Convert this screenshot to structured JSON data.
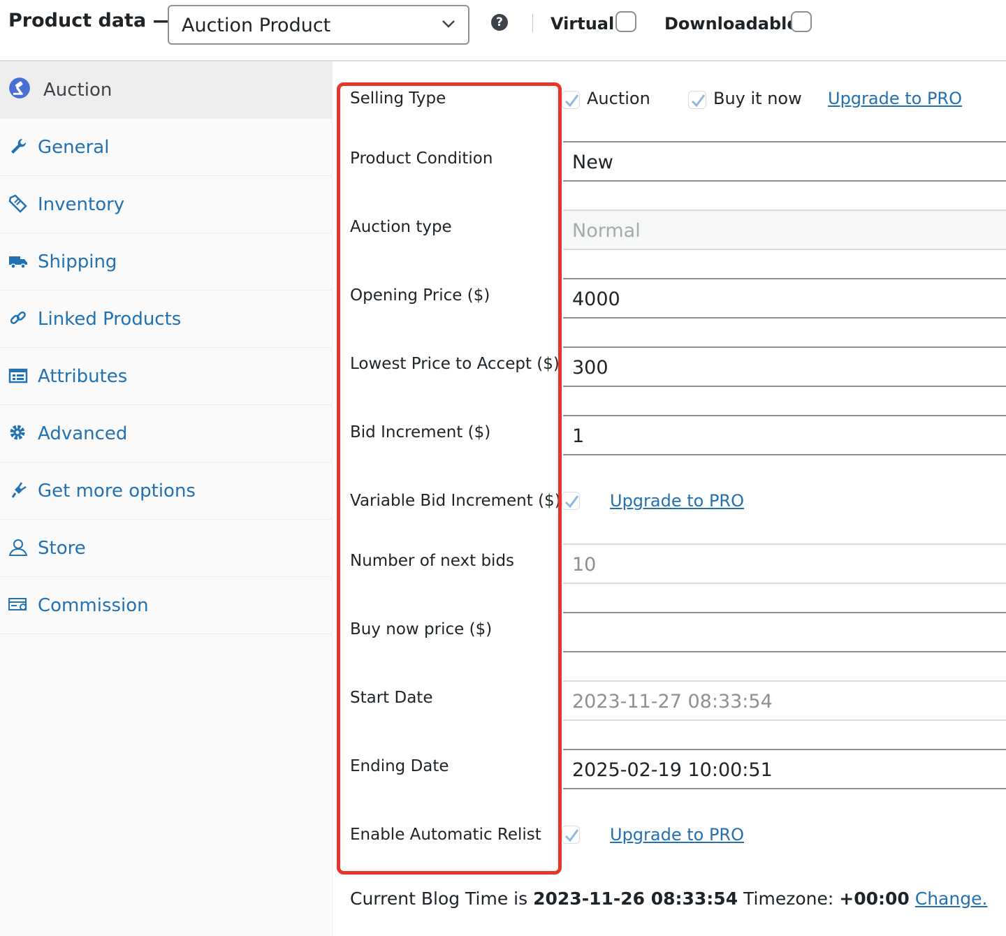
{
  "header": {
    "title": "Product data —",
    "product_type": "Auction Product",
    "help_symbol": "?",
    "virtual_label": "Virtual:",
    "downloadable_label": "Downloadable:"
  },
  "sidebar": {
    "items": [
      {
        "label": "Auction",
        "icon": "auction-icon",
        "active": true
      },
      {
        "label": "General",
        "icon": "wrench-icon"
      },
      {
        "label": "Inventory",
        "icon": "tag-icon"
      },
      {
        "label": "Shipping",
        "icon": "truck-icon"
      },
      {
        "label": "Linked Products",
        "icon": "link-icon"
      },
      {
        "label": "Attributes",
        "icon": "list-icon"
      },
      {
        "label": "Advanced",
        "icon": "gear-icon"
      },
      {
        "label": "Get more options",
        "icon": "plug-icon"
      },
      {
        "label": "Store",
        "icon": "user-icon"
      },
      {
        "label": "Commission",
        "icon": "card-icon"
      }
    ]
  },
  "form": {
    "selling_type": {
      "label": "Selling Type",
      "options": [
        {
          "label": "Auction",
          "checked": true
        },
        {
          "label": "Buy it now",
          "checked": true
        }
      ],
      "upgrade": "Upgrade to PRO"
    },
    "product_condition": {
      "label": "Product Condition",
      "value": "New"
    },
    "auction_type": {
      "label": "Auction type",
      "value": "Normal"
    },
    "opening_price": {
      "label": "Opening Price ($)",
      "value": "4000"
    },
    "lowest_price": {
      "label": "Lowest Price to Accept ($)",
      "value": "300"
    },
    "bid_increment": {
      "label": "Bid Increment ($)",
      "value": "1"
    },
    "variable_bid_increment": {
      "label": "Variable Bid Increment ($)",
      "checked": true,
      "upgrade": "Upgrade to PRO"
    },
    "next_bids": {
      "label": "Number of next bids",
      "value": "10"
    },
    "buy_now_price": {
      "label": "Buy now price ($)",
      "value": ""
    },
    "start_date": {
      "label": "Start Date",
      "value": "2023-11-27 08:33:54"
    },
    "ending_date": {
      "label": "Ending Date",
      "value": "2025-02-19 10:00:51"
    },
    "auto_relist": {
      "label": "Enable Automatic Relist",
      "checked": true,
      "upgrade": "Upgrade to PRO"
    }
  },
  "footer": {
    "prefix": "Current Blog Time is",
    "time": "2023-11-26 08:33:54",
    "tz_label": "Timezone:",
    "tz": "+00:00",
    "change": "Change."
  },
  "colors": {
    "link": "#2271b1",
    "highlight_border": "#e8342a",
    "check": "#8fb8e0"
  }
}
